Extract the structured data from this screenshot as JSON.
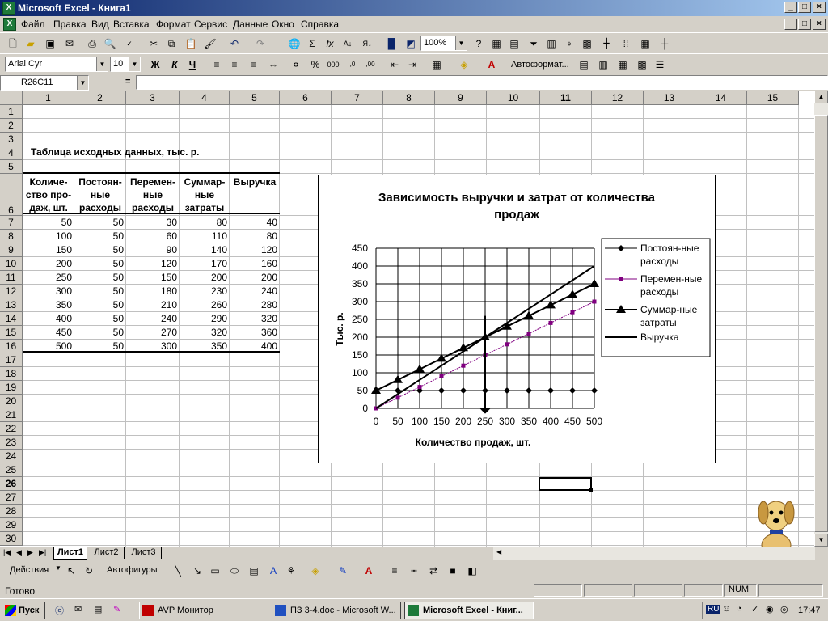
{
  "window": {
    "title": "Microsoft Excel - Книга1",
    "min": "_",
    "max": "□",
    "close": "×"
  },
  "menu": [
    "Файл",
    "Правка",
    "Вид",
    "Вставка",
    "Формат",
    "Сервис",
    "Данные",
    "Окно",
    "Справка"
  ],
  "toolbar": {
    "zoom": "100%",
    "font_name": "Arial Cyr",
    "font_size": "10",
    "bold": "Ж",
    "italic": "К",
    "underline": "Ч",
    "autoformat": "Автоформат..."
  },
  "formula": {
    "name_box": "R26C11",
    "equals": "=",
    "value": ""
  },
  "columns": [
    "1",
    "2",
    "3",
    "4",
    "5",
    "6",
    "7",
    "8",
    "9",
    "10",
    "11",
    "12",
    "13",
    "14",
    "15"
  ],
  "rows": [
    "1",
    "2",
    "3",
    "4",
    "5",
    "6",
    "7",
    "8",
    "9",
    "10",
    "11",
    "12",
    "13",
    "14",
    "15",
    "16",
    "17",
    "18",
    "19",
    "20",
    "21",
    "22",
    "23",
    "24",
    "25",
    "26",
    "27",
    "28",
    "29",
    "30"
  ],
  "sheet": {
    "title": "Таблица исходных данных, тыс. р.",
    "headers": [
      [
        "Количе-",
        "ство про-",
        "даж, шт."
      ],
      [
        "Постоян-",
        "ные",
        "расходы"
      ],
      [
        "Перемен-",
        "ные",
        "расходы"
      ],
      [
        "Суммар-",
        "ные",
        "затраты"
      ],
      [
        "Выручка",
        "",
        ""
      ]
    ],
    "rows": [
      [
        "50",
        "50",
        "30",
        "80",
        "40"
      ],
      [
        "100",
        "50",
        "60",
        "110",
        "80"
      ],
      [
        "150",
        "50",
        "90",
        "140",
        "120"
      ],
      [
        "200",
        "50",
        "120",
        "170",
        "160"
      ],
      [
        "250",
        "50",
        "150",
        "200",
        "200"
      ],
      [
        "300",
        "50",
        "180",
        "230",
        "240"
      ],
      [
        "350",
        "50",
        "210",
        "260",
        "280"
      ],
      [
        "400",
        "50",
        "240",
        "290",
        "320"
      ],
      [
        "450",
        "50",
        "270",
        "320",
        "360"
      ],
      [
        "500",
        "50",
        "300",
        "350",
        "400"
      ]
    ]
  },
  "chart_data": {
    "type": "line",
    "title": "Зависимость выручки и затрат от количества продаж",
    "xlabel": "Количество продаж, шт.",
    "ylabel": "Тыс. р.",
    "x": [
      0,
      50,
      100,
      150,
      200,
      250,
      300,
      350,
      400,
      450,
      500
    ],
    "xlim": [
      0,
      500
    ],
    "ylim": [
      0,
      450
    ],
    "x_ticks": [
      "0",
      "50",
      "100",
      "150",
      "200",
      "250",
      "300",
      "350",
      "400",
      "450",
      "500"
    ],
    "y_ticks": [
      "0",
      "50",
      "100",
      "150",
      "200",
      "250",
      "300",
      "350",
      "400",
      "450"
    ],
    "grid": true,
    "legend_position": "right",
    "series": [
      {
        "name": "Постоян-ные расходы",
        "values": [
          50,
          50,
          50,
          50,
          50,
          50,
          50,
          50,
          50,
          50,
          50
        ],
        "color": "#000000",
        "marker": "diamond"
      },
      {
        "name": "Перемен-ные расходы",
        "values": [
          0,
          30,
          60,
          90,
          120,
          150,
          180,
          210,
          240,
          270,
          300
        ],
        "color": "#800080",
        "marker": "square"
      },
      {
        "name": "Суммар-ные затраты",
        "values": [
          50,
          80,
          110,
          140,
          170,
          200,
          230,
          260,
          290,
          320,
          350
        ],
        "color": "#000000",
        "marker": "triangle"
      },
      {
        "name": "Выручка",
        "values": [
          0,
          40,
          80,
          120,
          160,
          200,
          240,
          280,
          320,
          360,
          400
        ],
        "color": "#000000",
        "marker": "none"
      }
    ],
    "annotation": {
      "type": "arrow",
      "x": 250
    }
  },
  "tabs": [
    "Лист1",
    "Лист2",
    "Лист3"
  ],
  "drawing": {
    "actions": "Действия",
    "autoshapes": "Автофигуры"
  },
  "status": {
    "ready": "Готово",
    "num": "NUM"
  },
  "taskbar": {
    "start": "Пуск",
    "tasks": [
      "AVP Монитор",
      "ПЗ 3-4.doc - Microsoft W...",
      "Microsoft Excel - Книг..."
    ],
    "lang": "RU",
    "time": "17:47"
  }
}
